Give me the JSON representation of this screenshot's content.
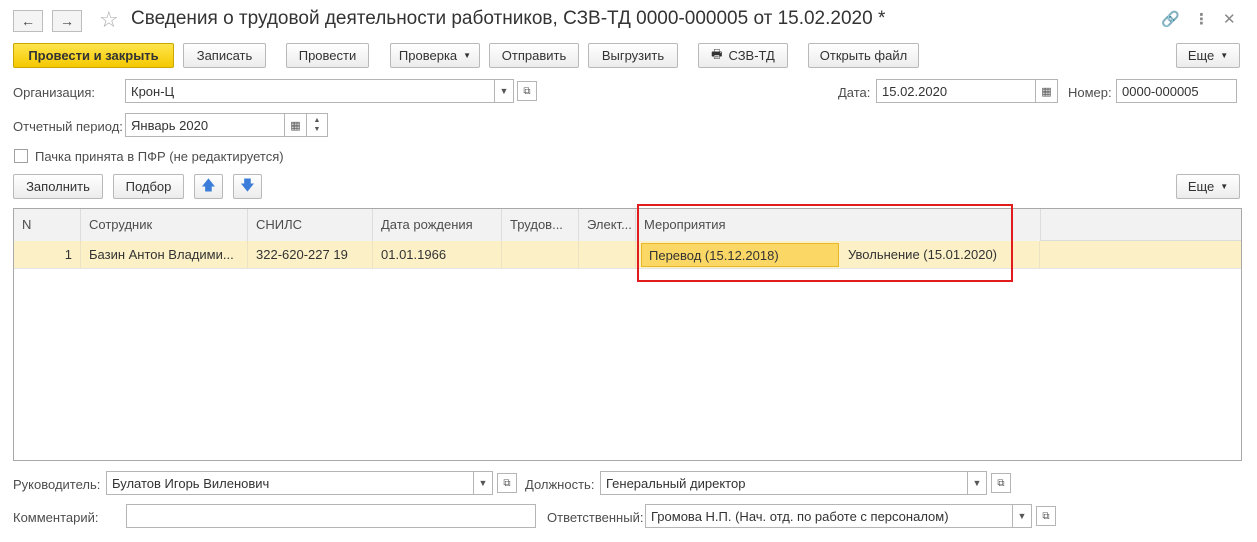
{
  "window": {
    "title": "Сведения о трудовой деятельности работников, СЗВ-ТД 0000-000005 от 15.02.2020 *"
  },
  "toolbar": {
    "post_close": "Провести и закрыть",
    "save": "Записать",
    "post": "Провести",
    "check": "Проверка",
    "send": "Отправить",
    "export": "Выгрузить",
    "print": "СЗВ-ТД",
    "open_file": "Открыть файл",
    "more": "Еще"
  },
  "form": {
    "organization_label": "Организация:",
    "organization_value": "Крон-Ц",
    "date_label": "Дата:",
    "date_value": "15.02.2020",
    "number_label": "Номер:",
    "number_value": "0000-000005",
    "period_label": "Отчетный период:",
    "period_value": "Январь 2020",
    "accepted_label": "Пачка принята в ПФР (не редактируется)"
  },
  "table_toolbar": {
    "fill": "Заполнить",
    "select": "Подбор",
    "more": "Еще"
  },
  "table": {
    "headers": [
      "N",
      "Сотрудник",
      "СНИЛС",
      "Дата рождения",
      "Трудов...",
      "Элект...",
      "Мероприятия"
    ],
    "rows": [
      {
        "n": "1",
        "employee": "Базин Антон Владими...",
        "snils": "322-620-227 19",
        "birth_date": "01.01.1966",
        "labor": "",
        "electronic": "",
        "event1": "Перевод (15.12.2018)",
        "event2": "Увольнение (15.01.2020)"
      }
    ]
  },
  "footer": {
    "head_label": "Руководитель:",
    "head_value": "Булатов Игорь Виленович",
    "position_label": "Должность:",
    "position_value": "Генеральный директор",
    "comment_label": "Комментарий:",
    "comment_value": "",
    "responsible_label": "Ответственный:",
    "responsible_value": "Громова Н.П. (Нач. отд. по работе с персоналом)"
  },
  "colors": {
    "primary_button": "#f5c900",
    "selected_row": "#fbf0c6",
    "active_cell": "#fbd865",
    "highlight_frame": "#e01c1c"
  }
}
